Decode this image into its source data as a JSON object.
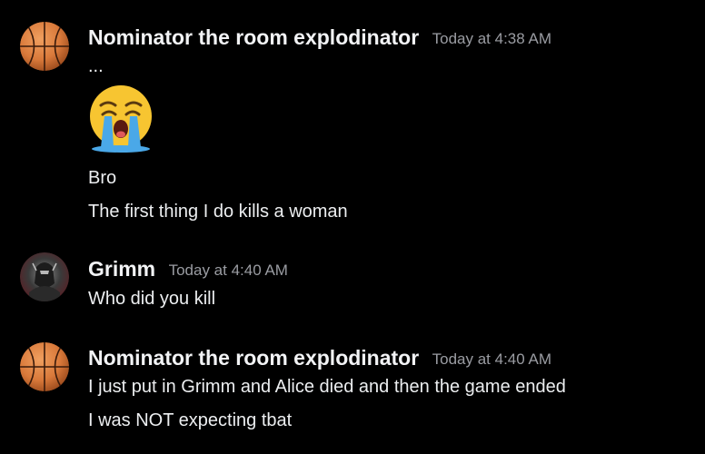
{
  "messages": [
    {
      "author": "Nominator the room explodinator",
      "avatar_icon": "basketball-icon",
      "timestamp": "Today at 4:38 AM",
      "lines": [
        "...",
        "Bro",
        "The first thing I do kills a woman"
      ],
      "emoji": "loudly-crying-face-icon"
    },
    {
      "author": "Grimm",
      "avatar_icon": "dark-knight-avatar-icon",
      "timestamp": "Today at 4:40 AM",
      "lines": [
        "Who did you kill"
      ]
    },
    {
      "author": "Nominator the room explodinator",
      "avatar_icon": "basketball-icon",
      "timestamp": "Today at 4:40 AM",
      "lines": [
        "I just put in Grimm and Alice died and then the game ended",
        "I was NOT expecting tbat"
      ]
    }
  ],
  "colors": {
    "background": "#000000",
    "username": "#f2f3f5",
    "timestamp": "#9a9ca2",
    "message_text": "#eceef0",
    "basketball": "#d9793a"
  }
}
